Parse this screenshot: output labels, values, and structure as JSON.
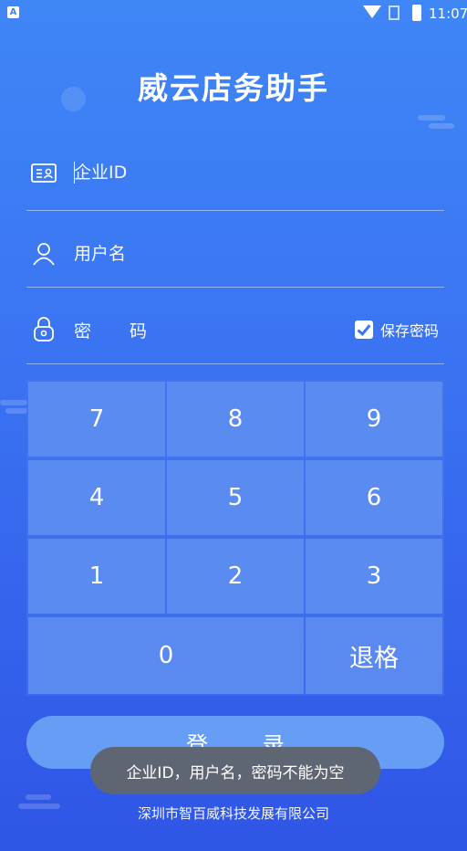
{
  "status_bar": {
    "time": "11:07",
    "app_icon_letter": "A"
  },
  "app": {
    "title": "威云店务助手"
  },
  "form": {
    "company_id_placeholder": "企业ID",
    "username_placeholder": "用户名",
    "password_placeholder": "密 码",
    "save_password_label": "保存密码",
    "save_password_checked": true
  },
  "keypad": {
    "keys": [
      "7",
      "8",
      "9",
      "4",
      "5",
      "6",
      "1",
      "2",
      "3",
      "0"
    ],
    "backspace_label": "退格"
  },
  "login_button": {
    "label": "登 录"
  },
  "toast": {
    "message": "企业ID，用户名，密码不能为空"
  },
  "footer": {
    "company": "深圳市智百威科技发展有限公司"
  },
  "icons": {
    "company": "id-card-icon",
    "user": "user-icon",
    "password": "lock-icon"
  },
  "colors": {
    "background_top": "#3f86f6",
    "background_bottom": "#2f55e6",
    "accent": "#3a78f3"
  }
}
